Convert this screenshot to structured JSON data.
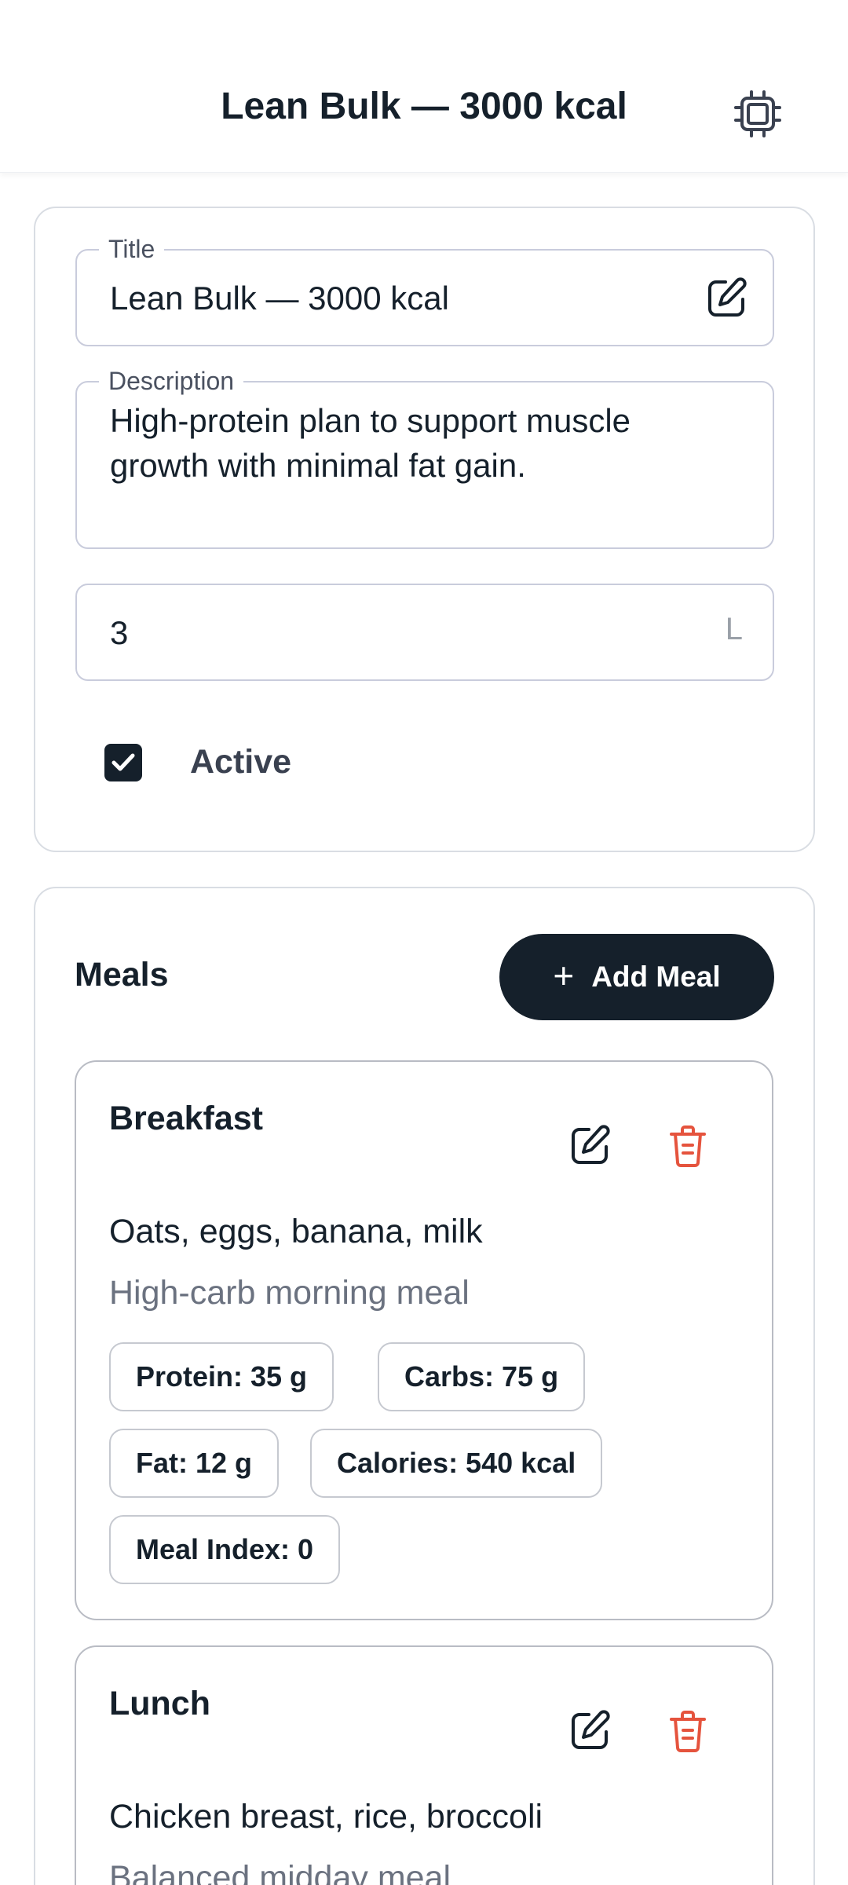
{
  "header": {
    "title": "Lean Bulk — 3000 kcal",
    "settings_icon": "cpu-chip-icon"
  },
  "form": {
    "title_label": "Title",
    "title_value": "Lean Bulk — 3000 kcal",
    "description_label": "Description",
    "description_value": "High-protein plan to support muscle growth with minimal fat gain.",
    "quantity_value": "3",
    "quantity_unit": "L",
    "active_label": "Active",
    "active_checked": true
  },
  "meals": {
    "section_title": "Meals",
    "add_button_label": "Add Meal",
    "items": [
      {
        "name": "Breakfast",
        "foods": "Oats, eggs, banana, milk",
        "note": "High-carb morning meal",
        "chips": {
          "protein": "Protein: 35 g",
          "carbs": "Carbs: 75 g",
          "fat": "Fat: 12 g",
          "calories": "Calories: 540 kcal",
          "index": "Meal Index: 0"
        }
      },
      {
        "name": "Lunch",
        "foods": "Chicken breast, rice, broccoli",
        "note": "Balanced midday meal"
      }
    ]
  },
  "colors": {
    "primary": "#15202b",
    "delete": "#e5533d",
    "muted": "#6b7280",
    "border": "#c9ccdc"
  }
}
